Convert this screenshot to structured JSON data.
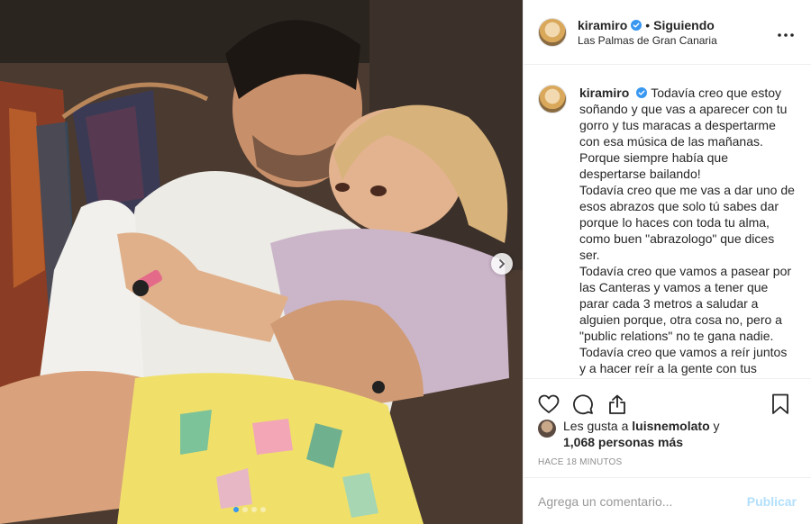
{
  "post": {
    "username": "kiramiro",
    "separator": "•",
    "follow_status": "Siguiendo",
    "location": "Las Palmas de Gran Canaria",
    "more_icon": "more-horizontal-icon",
    "caption": "Todavía creo que estoy soñando y que vas a aparecer con tu gorro y tus maracas a despertarme con esa música de las mañanas. Porque siempre había que despertarse bailando!\nTodavía creo que me vas a dar uno de esos abrazos que solo tú sabes dar porque lo haces con toda tu alma, como buen \"abrazologo\" que dices ser.\nTodavía creo que vamos a pasear por las Canteras y vamos a tener que parar cada 3 metros a saludar a alguien porque, otra cosa no, pero a \"public relations\" no te gana nadie.\nTodavía creo que vamos a reír juntos y a hacer reír a la gente con tus bromas y tu particular sentido del humor, tan único, tan tuyo..."
  },
  "likes": {
    "prefix": "Les gusta a ",
    "user": "luisnemolato",
    "conj": " y",
    "count": "1,068 personas más"
  },
  "timestamp": "HACE 18 MINUTOS",
  "comment": {
    "placeholder": "Agrega un comentario...",
    "publish_label": "Publicar"
  },
  "carousel": {
    "total": 4,
    "active": 1
  },
  "icons": [
    "heart-icon",
    "comment-icon",
    "share-icon",
    "bookmark-icon",
    "chevron-right-icon",
    "verified-badge-icon"
  ],
  "colors": {
    "accent": "#3897f0",
    "publish_disabled": "#b2dffc",
    "muted": "#8e8e8e"
  }
}
